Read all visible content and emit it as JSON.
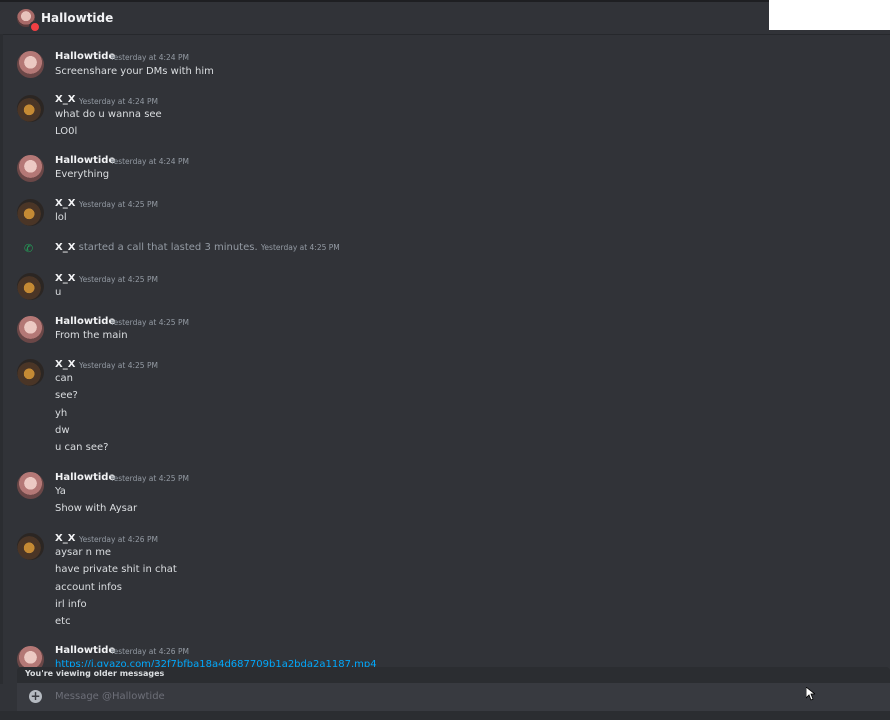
{
  "header": {
    "title": "Hallowtide"
  },
  "messages": [
    {
      "author": "Hallowtide",
      "timestamp": "Yesterday at 4:24 PM",
      "lines": [
        "Screenshare your DMs with him"
      ]
    },
    {
      "author": "X_X",
      "timestamp": "Yesterday at 4:24 PM",
      "lines": [
        "what do u wanna see",
        "LO0l"
      ]
    },
    {
      "author": "Hallowtide",
      "timestamp": "Yesterday at 4:24 PM",
      "lines": [
        "Everything"
      ]
    },
    {
      "author": "X_X",
      "timestamp": "Yesterday at 4:25 PM",
      "lines": [
        "lol"
      ]
    },
    {
      "author": "X_X",
      "timestamp": "Yesterday at 4:25 PM",
      "lines": [
        "u"
      ]
    },
    {
      "author": "Hallowtide",
      "timestamp": "Yesterday at 4:25 PM",
      "lines": [
        "From the main"
      ]
    },
    {
      "author": "X_X",
      "timestamp": "Yesterday at 4:25 PM",
      "lines": [
        "can",
        "see?",
        "yh",
        "dw",
        "u can see?"
      ]
    },
    {
      "author": "Hallowtide",
      "timestamp": "Yesterday at 4:25 PM",
      "lines": [
        "Ya",
        "Show with Aysar"
      ]
    },
    {
      "author": "X_X",
      "timestamp": "Yesterday at 4:26 PM",
      "lines": [
        "aysar n me",
        "have private shit in chat",
        "account infos",
        "irl info",
        "etc"
      ]
    },
    {
      "author": "Hallowtide",
      "timestamp": "Yesterday at 4:26 PM",
      "lines": [
        "https://i.gyazo.com/32f7bfba18a4d687709b1a2bda2a1187.mp4"
      ]
    }
  ],
  "call_event": {
    "author": "X_X",
    "text": "started a call that lasted 3 minutes.",
    "timestamp": "Yesterday at 4:25 PM",
    "icon": "phone-icon"
  },
  "older_notice": "You're viewing older messages",
  "composer": {
    "placeholder": "Message @Hallowtide"
  },
  "colors": {
    "background": "#313338",
    "link": "#00a8fc",
    "call_green": "#23a55a"
  }
}
